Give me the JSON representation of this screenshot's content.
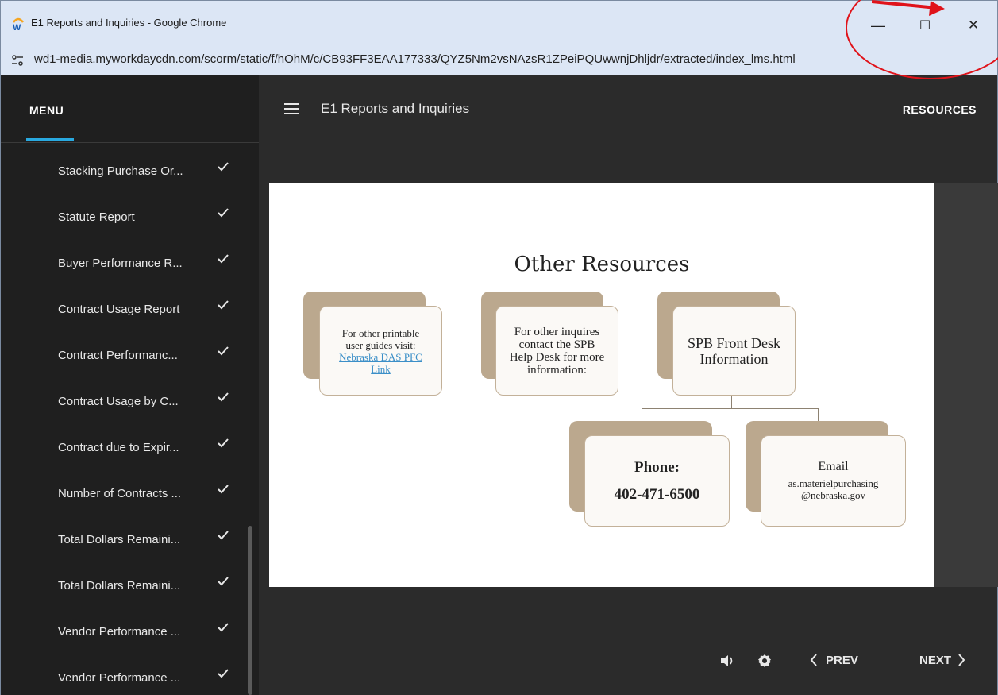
{
  "window": {
    "title": "E1 Reports and Inquiries - Google Chrome",
    "url": "wd1-media.myworkdaycdn.com/scorm/static/f/hOhM/c/CB93FF3EAA177333/QYZ5Nm2vsNAzsR1ZPeiPQUwwnjDhljdr/extracted/index_lms.html",
    "minimize": "—",
    "maximize": "☐",
    "close": "✕"
  },
  "sidebar": {
    "menu_label": "MENU",
    "items": [
      {
        "label": "Stacking Purchase Or..."
      },
      {
        "label": "Statute Report"
      },
      {
        "label": "Buyer Performance R..."
      },
      {
        "label": "Contract Usage Report"
      },
      {
        "label": "Contract Performanc..."
      },
      {
        "label": "Contract Usage by C..."
      },
      {
        "label": "Contract due to Expir..."
      },
      {
        "label": "Number of Contracts ..."
      },
      {
        "label": "Total Dollars Remaini..."
      },
      {
        "label": "Total Dollars Remaini..."
      },
      {
        "label": "Vendor Performance ..."
      },
      {
        "label": "Vendor Performance ..."
      }
    ]
  },
  "header": {
    "course_title": "E1 Reports and Inquiries",
    "resources_label": "RESOURCES"
  },
  "slide": {
    "title": "Other Resources",
    "card1": {
      "line1": "For other printable",
      "line2": "user guides visit:",
      "link1": "Nebraska DAS PFC",
      "link2": "Link"
    },
    "card2": {
      "line1": "For other inquires",
      "line2": "contact the SPB",
      "line3": "Help Desk for more",
      "line4": "information:"
    },
    "card3": {
      "line1": "SPB Front Desk",
      "line2": "Information"
    },
    "card4": {
      "line1": "Phone:",
      "line2": "402-471-6500"
    },
    "card5": {
      "line1": "Email",
      "line2": "as.materielpurchasing",
      "line3": "@nebraska.gov"
    }
  },
  "controls": {
    "prev_label": "PREV",
    "next_label": "NEXT"
  },
  "colors": {
    "accent": "#29a9e0",
    "card_back": "#bba88e",
    "annotation": "#e0131a"
  }
}
